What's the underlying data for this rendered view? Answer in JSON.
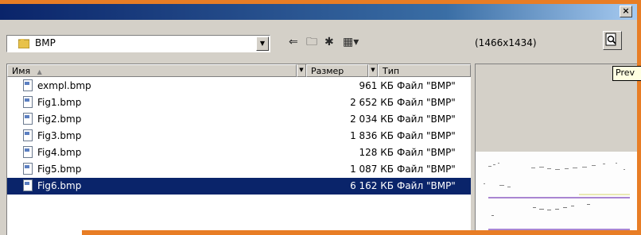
{
  "window": {
    "close_label": "×"
  },
  "location": {
    "folder": "BMP",
    "dropdown_arrow": "▼"
  },
  "toolbar": {
    "back_icon": "⇐",
    "up_icon": "🗀",
    "new_folder_icon": "✱",
    "view_menu_icon": "▦▾"
  },
  "preview": {
    "dimensions": "(1466x1434)",
    "tooltip": "Prev"
  },
  "columns": [
    {
      "label": "Имя",
      "sort_icon": "▲"
    },
    {
      "label": "Размер"
    },
    {
      "label": "Тип"
    }
  ],
  "files": [
    {
      "name": "exmpl.bmp",
      "size": "961 КБ",
      "type": "Файл \"BMP\""
    },
    {
      "name": "Fig1.bmp",
      "size": "2 652 КБ",
      "type": "Файл \"BMP\""
    },
    {
      "name": "Fig2.bmp",
      "size": "2 034 КБ",
      "type": "Файл \"BMP\""
    },
    {
      "name": "Fig3.bmp",
      "size": "1 836 КБ",
      "type": "Файл \"BMP\""
    },
    {
      "name": "Fig4.bmp",
      "size": "128 КБ",
      "type": "Файл \"BMP\""
    },
    {
      "name": "Fig5.bmp",
      "size": "1 087 КБ",
      "type": "Файл \"BMP\""
    },
    {
      "name": "Fig6.bmp",
      "size": "6 162 КБ",
      "type": "Файл \"BMP\"",
      "selected": true
    }
  ],
  "colors": {
    "selection": "#0a246a",
    "background_accent": "#e87d25"
  }
}
